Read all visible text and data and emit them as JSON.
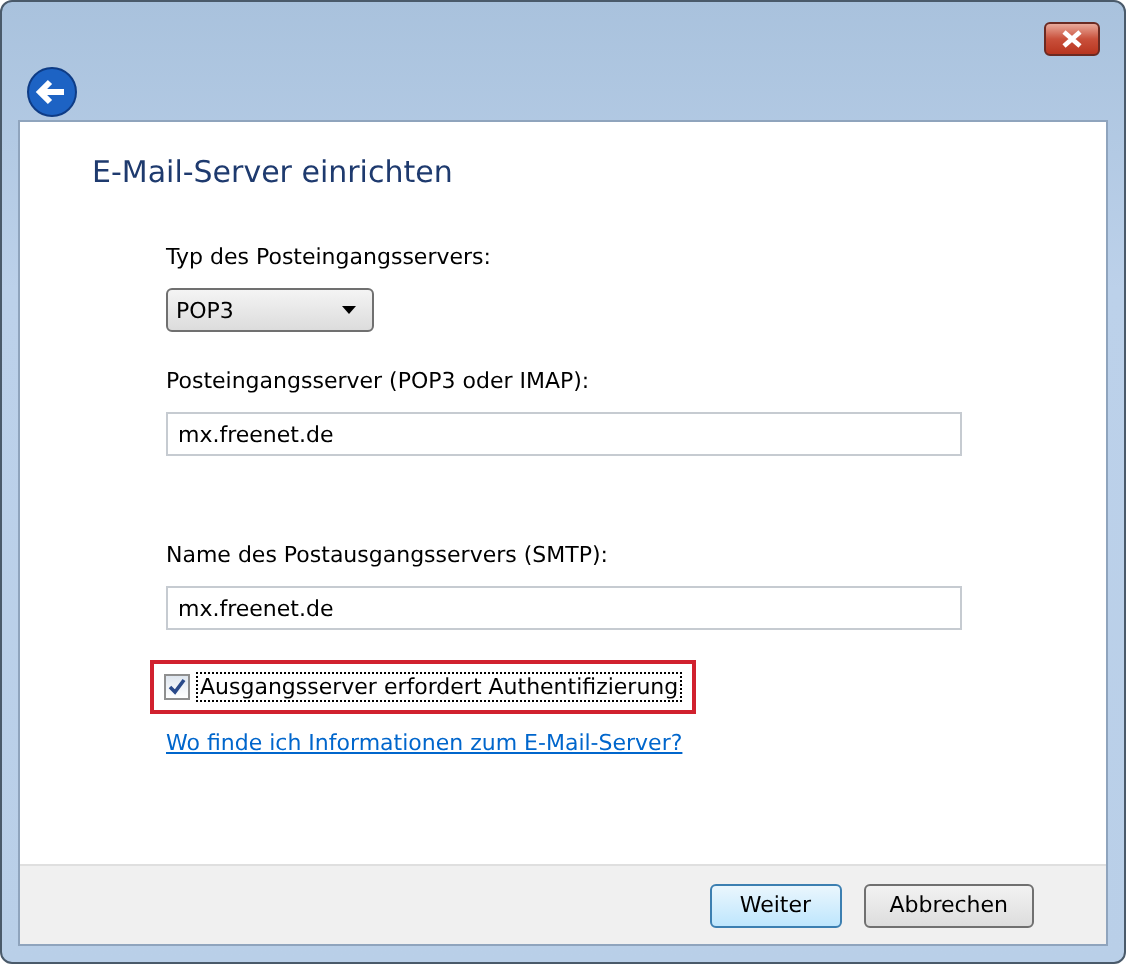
{
  "window": {
    "title": "E-Mail-Server einrichten"
  },
  "incoming_type": {
    "label": "Typ des Posteingangsservers:",
    "value": "POP3"
  },
  "incoming_server": {
    "label": "Posteingangsserver (POP3 oder IMAP):",
    "value": "mx.freenet.de"
  },
  "outgoing_server": {
    "label": "Name des Postausgangsservers (SMTP):",
    "value": "mx.freenet.de"
  },
  "auth_checkbox": {
    "label": "Ausgangsserver erfordert Authentifizierung",
    "checked": true,
    "highlighted": true
  },
  "help_link": "Wo finde ich Informationen zum E-Mail-Server?",
  "buttons": [
    {
      "label": "Weiter",
      "default": true
    },
    {
      "label": "Abbrechen",
      "default": false
    }
  ]
}
